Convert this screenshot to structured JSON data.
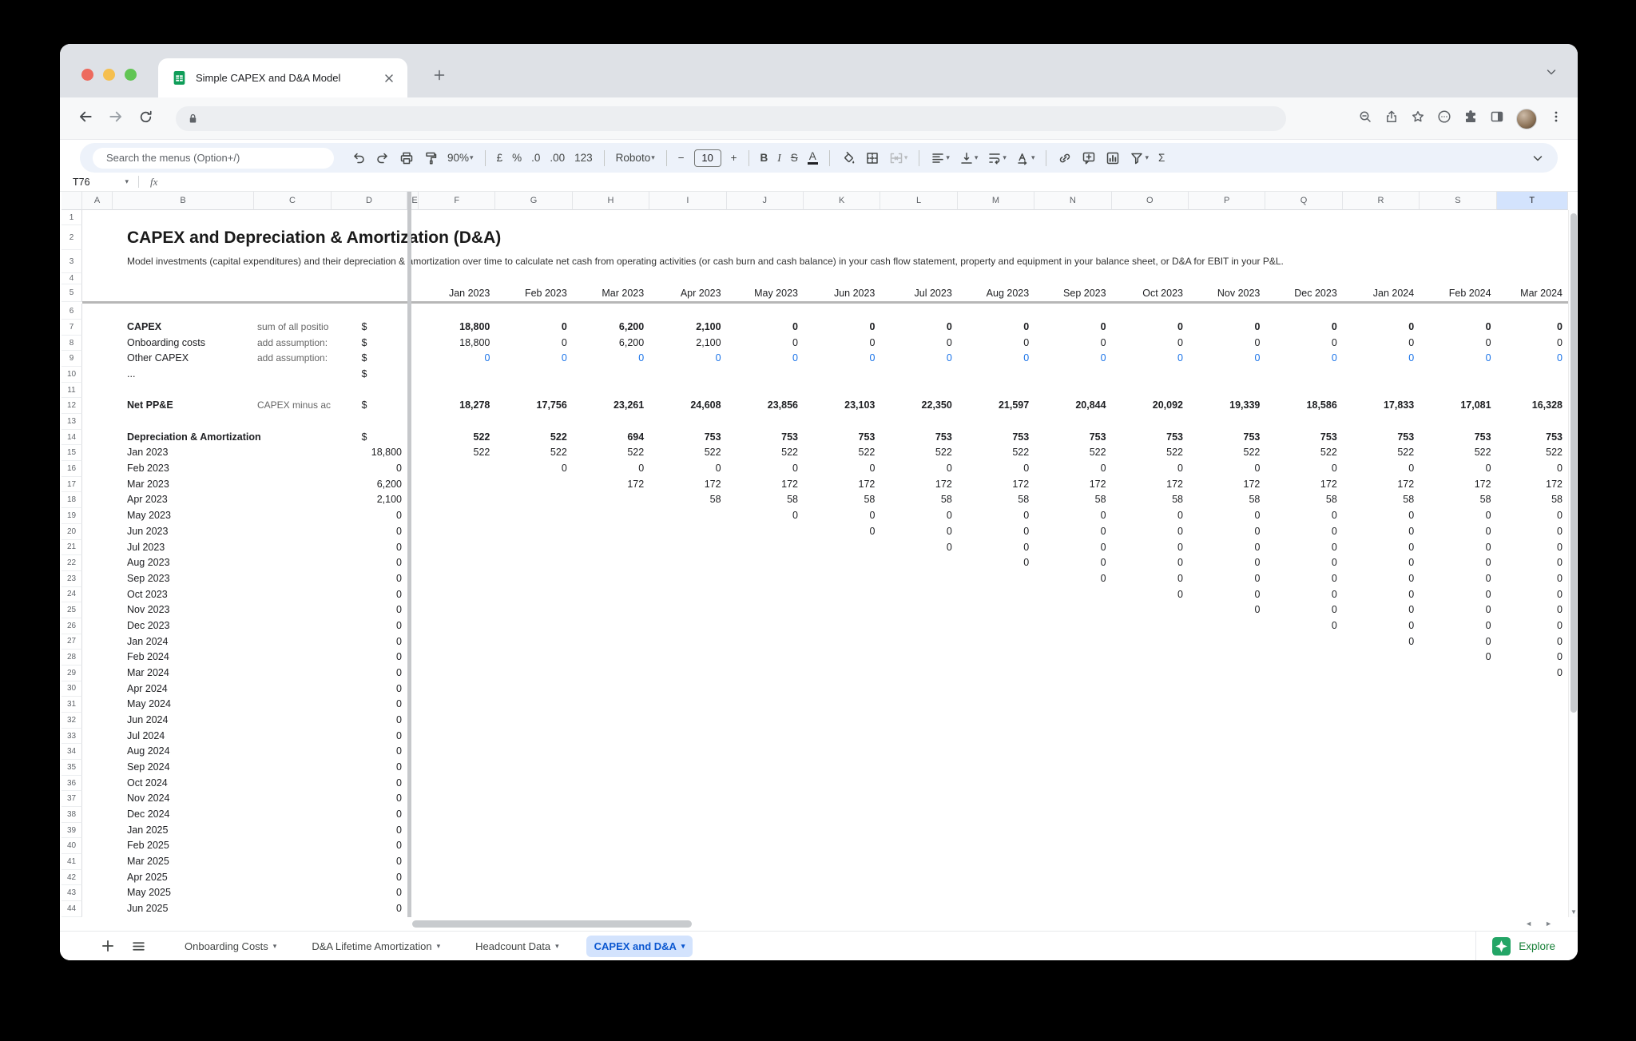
{
  "browser": {
    "tab_title": "Simple CAPEX and D&A Model",
    "traffic_lights": [
      "#ed6a5e",
      "#f5bf4f",
      "#61c554"
    ],
    "nav_icons": [
      "back-icon",
      "forward-icon",
      "reload-icon"
    ],
    "right_icons": [
      "zoom-icon",
      "share-icon",
      "bookmark-star-icon",
      "dev-console-icon",
      "extensions-puzzle-icon",
      "sidebar-icon",
      "avatar",
      "menu-kebab-icon"
    ]
  },
  "toolbar": {
    "search_placeholder": "Search the menus (Option+/)",
    "items": [
      {
        "k": "i",
        "n": "undo-icon"
      },
      {
        "k": "i",
        "n": "redo-icon"
      },
      {
        "k": "i",
        "n": "print-icon"
      },
      {
        "k": "i",
        "n": "paint-format-icon"
      },
      {
        "k": "z",
        "n": "zoom-select",
        "l": "90%"
      },
      {
        "k": "d"
      },
      {
        "k": "t",
        "n": "currency-format-button",
        "l": "£"
      },
      {
        "k": "t",
        "n": "percent-format-button",
        "l": "%"
      },
      {
        "k": "t",
        "n": "decrease-decimals-button",
        "l": ".0"
      },
      {
        "k": "t",
        "n": "increase-decimals-button",
        "l": ".00"
      },
      {
        "k": "t",
        "n": "more-formats-button",
        "l": "123"
      },
      {
        "k": "d"
      },
      {
        "k": "z",
        "n": "font-select",
        "l": "Roboto"
      },
      {
        "k": "d"
      },
      {
        "k": "t",
        "n": "font-size-decrease-button",
        "l": "−"
      },
      {
        "k": "s",
        "n": "font-size-input",
        "l": "10"
      },
      {
        "k": "t",
        "n": "font-size-increase-button",
        "l": "+"
      },
      {
        "k": "d"
      },
      {
        "k": "t",
        "n": "bold-button",
        "l": "B",
        "cls": "b"
      },
      {
        "k": "t",
        "n": "italic-button",
        "l": "I",
        "cls": "it"
      },
      {
        "k": "t",
        "n": "strikethrough-button",
        "l": "S",
        "cls": "st"
      },
      {
        "k": "t",
        "n": "text-color-button",
        "l": "A",
        "cls": "tc"
      },
      {
        "k": "d"
      },
      {
        "k": "i",
        "n": "fill-color-icon"
      },
      {
        "k": "i",
        "n": "borders-icon"
      },
      {
        "k": "i",
        "n": "merge-cells-icon",
        "dis": true,
        "arrow": true
      },
      {
        "k": "d"
      },
      {
        "k": "i",
        "n": "horizontal-align-icon",
        "arrow": true
      },
      {
        "k": "i",
        "n": "vertical-align-icon",
        "arrow": true
      },
      {
        "k": "i",
        "n": "text-wrap-icon",
        "arrow": true
      },
      {
        "k": "i",
        "n": "text-rotation-icon",
        "arrow": true
      },
      {
        "k": "d"
      },
      {
        "k": "i",
        "n": "insert-link-icon"
      },
      {
        "k": "i",
        "n": "insert-comment-icon"
      },
      {
        "k": "i",
        "n": "insert-chart-icon"
      },
      {
        "k": "i",
        "n": "filter-icon",
        "arrow": true
      },
      {
        "k": "t",
        "n": "functions-button",
        "l": "Σ"
      }
    ]
  },
  "formula_bar": {
    "name_box": "T76",
    "fx_label": "fx"
  },
  "grid": {
    "col_letters": [
      "A",
      "B",
      "C",
      "D",
      "E",
      "F",
      "G",
      "H",
      "I",
      "J",
      "K",
      "L",
      "M",
      "N",
      "O",
      "P",
      "Q",
      "R",
      "S",
      "T"
    ],
    "active_col": "T",
    "row_count": 44,
    "title": "CAPEX and Depreciation & Amortization (D&A)",
    "description": "Model investments (capital expenditures) and their depreciation & amortization over time to calculate net cash from operating activities (or cash burn and cash balance) in your cash flow statement, property and equipment in your balance sheet, or D&A for EBIT in your P&L.",
    "month_columns": [
      "Jan 2023",
      "Feb 2023",
      "Mar 2023",
      "Apr 2023",
      "May 2023",
      "Jun 2023",
      "Jul 2023",
      "Aug 2023",
      "Sep 2023",
      "Oct 2023",
      "Nov 2023",
      "Dec 2023",
      "Jan 2024",
      "Feb 2024",
      "Mar 2024"
    ],
    "sections": {
      "capex": {
        "label": "CAPEX",
        "note": "sum of all positio",
        "unit": "$",
        "values": [
          "18,800",
          "0",
          "6,200",
          "2,100",
          "0",
          "0",
          "0",
          "0",
          "0",
          "0",
          "0",
          "0",
          "0",
          "0",
          "0"
        ]
      },
      "onboarding": {
        "label": "Onboarding costs",
        "note": "add assumption:",
        "unit": "$",
        "values": [
          "18,800",
          "0",
          "6,200",
          "2,100",
          "0",
          "0",
          "0",
          "0",
          "0",
          "0",
          "0",
          "0",
          "0",
          "0",
          "0"
        ]
      },
      "other_capex": {
        "label": "Other CAPEX",
        "note": "add assumption:",
        "unit": "$",
        "values": [
          "0",
          "0",
          "0",
          "0",
          "0",
          "0",
          "0",
          "0",
          "0",
          "0",
          "0",
          "0",
          "0",
          "0",
          "0"
        ]
      },
      "dots": {
        "label": "...",
        "unit": "$"
      },
      "net_ppe": {
        "label": "Net PP&E",
        "note": "CAPEX minus ac",
        "unit": "$",
        "values": [
          "18,278",
          "17,756",
          "23,261",
          "24,608",
          "23,856",
          "23,103",
          "22,350",
          "21,597",
          "20,844",
          "20,092",
          "19,339",
          "18,586",
          "17,833",
          "17,081",
          "16,328"
        ]
      },
      "da_total": {
        "label": "Depreciation & Amortization",
        "unit": "$",
        "values": [
          "522",
          "522",
          "694",
          "753",
          "753",
          "753",
          "753",
          "753",
          "753",
          "753",
          "753",
          "753",
          "753",
          "753",
          "753"
        ]
      }
    },
    "schedule": {
      "months": [
        "Jan 2023",
        "Feb 2023",
        "Mar 2023",
        "Apr 2023",
        "May 2023",
        "Jun 2023",
        "Jul 2023",
        "Aug 2023",
        "Sep 2023",
        "Oct 2023",
        "Nov 2023",
        "Dec 2023",
        "Jan 2024",
        "Feb 2024",
        "Mar 2024",
        "Apr 2024",
        "May 2024",
        "Jun 2024",
        "Jul 2024",
        "Aug 2024",
        "Sep 2024",
        "Oct 2024",
        "Nov 2024",
        "Dec 2024",
        "Jan 2025",
        "Feb 2025",
        "Mar 2025",
        "Apr 2025",
        "May 2025",
        "Jun 2025"
      ],
      "d_values": [
        "18,800",
        "0",
        "6,200",
        "2,100",
        "0",
        "0",
        "0",
        "0",
        "0",
        "0",
        "0",
        "0",
        "0",
        "0",
        "0",
        "0",
        "0",
        "0",
        "0",
        "0",
        "0",
        "0",
        "0",
        "0",
        "0",
        "0",
        "0",
        "0",
        "0",
        "0"
      ],
      "row_values": [
        "522",
        "0",
        "172",
        "58",
        "0",
        "0",
        "0",
        "0",
        "0",
        "0",
        "0",
        "0",
        "0",
        "0",
        "0"
      ]
    }
  },
  "sheet_tabs": {
    "tabs": [
      {
        "label": "Onboarding Costs",
        "active": false
      },
      {
        "label": "D&A Lifetime Amortization",
        "active": false
      },
      {
        "label": "Headcount Data",
        "active": false
      },
      {
        "label": "CAPEX and D&A",
        "active": true
      }
    ],
    "explore_label": "Explore"
  },
  "colors": {
    "accent_blue": "#0b57d0",
    "active_tab_bg": "#d3e3fd",
    "input_link_blue": "#1a73e8",
    "explore_green": "#188038",
    "toolbar_bg": "#edf2fa"
  }
}
